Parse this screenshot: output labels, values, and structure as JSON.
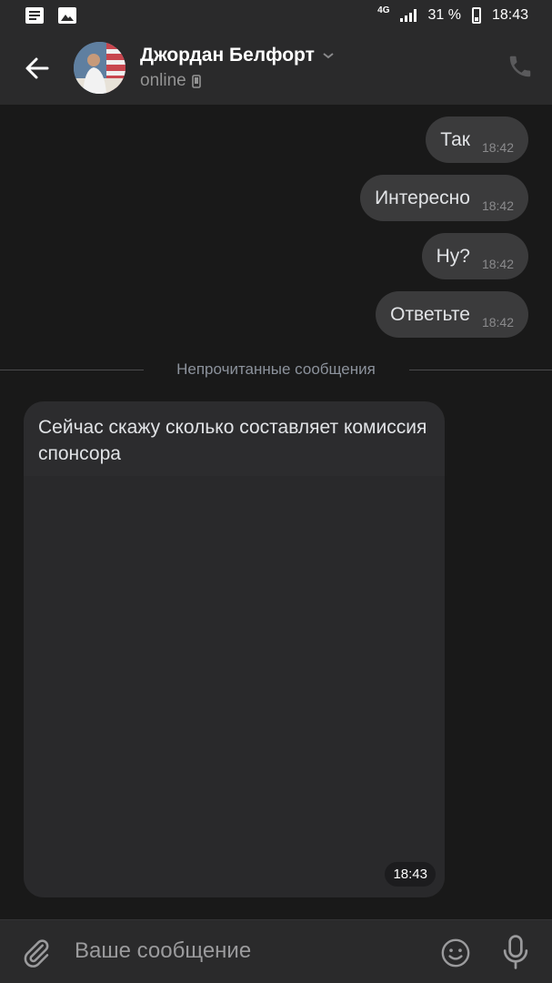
{
  "status_bar": {
    "network": "4G",
    "battery": "31 %",
    "time": "18:43",
    "icons": [
      "notification-news-icon",
      "notification-gallery-icon",
      "signal-icon",
      "battery-icon"
    ]
  },
  "header": {
    "name": "Джордан Белфорт",
    "status": "online",
    "icons": [
      "back-arrow-icon",
      "chevron-down-icon",
      "mobile-device-icon",
      "phone-icon"
    ]
  },
  "messages": {
    "outgoing": [
      {
        "text": "Так",
        "time": "18:42"
      },
      {
        "text": "Интересно",
        "time": "18:42"
      },
      {
        "text": "Ну?",
        "time": "18:42"
      },
      {
        "text": "Ответьте",
        "time": "18:42"
      }
    ],
    "unread_divider": "Непрочитанные сообщения",
    "incoming": {
      "text": "Сейчас скажу сколько составляет комиссия спонсора",
      "time": "18:43"
    }
  },
  "composer": {
    "placeholder": "Ваше сообщение",
    "icons": [
      "paperclip-icon",
      "emoji-icon",
      "microphone-icon"
    ]
  },
  "colors": {
    "background": "#191919",
    "bar": "#2a2a2b",
    "outgoing_bubble": "#3b3b3c",
    "incoming_bubble": "#2c2c2e",
    "muted_text": "#939393"
  }
}
